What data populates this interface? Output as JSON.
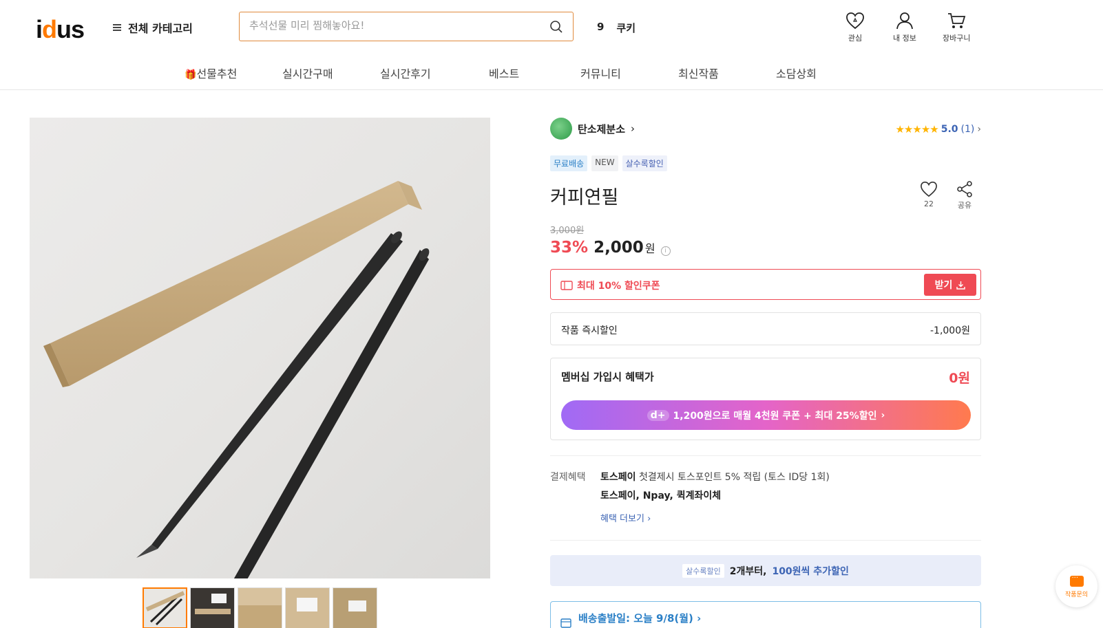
{
  "header": {
    "logo": {
      "left": "i",
      "o": "d",
      "right": "us"
    },
    "category_label": "전체 카테고리",
    "search_placeholder": "추석선물 미리 찜해놓아요!",
    "cookie_count": "9",
    "cookie_label": "쿠키",
    "icons": [
      {
        "name": "heart-icon",
        "label": "관심"
      },
      {
        "name": "user-icon",
        "label": "내 정보"
      },
      {
        "name": "cart-icon",
        "label": "장바구니"
      }
    ]
  },
  "nav": [
    {
      "label": "선물추천",
      "gift": true
    },
    {
      "label": "실시간구매"
    },
    {
      "label": "실시간후기"
    },
    {
      "label": "베스트"
    },
    {
      "label": "커뮤니티"
    },
    {
      "label": "최신작품"
    },
    {
      "label": "소담상회"
    }
  ],
  "product": {
    "shop_name": "탄소제분소",
    "rating_stars": "★★★★★",
    "rating_score": "5.0",
    "rating_count": "(1)",
    "badges": [
      "무료배송",
      "NEW",
      "살수록할인"
    ],
    "title": "커피연필",
    "like_count": "22",
    "share_label": "공유",
    "original_price": "3,000원",
    "discount_pct": "33%",
    "price": "2,000",
    "price_unit": "원",
    "coupon_text": "최대 10% 할인쿠폰",
    "coupon_button": "받기",
    "instant_label": "작품 즉시할인",
    "instant_value": "-1,000원",
    "member_label": "멤버십 가입시 혜택가",
    "member_value": "0원",
    "member_button": "1,200원으로 매월 4천원 쿠폰 + 최대 25%할인",
    "member_badge": "d+",
    "payment_label": "결제혜택",
    "payment_bold": "토스페이",
    "payment_line1": "첫결제시 토스포인트 5% 적립 (토스 ID당 1회)",
    "payment_line2": "토스페이, Npay, 퀵계좌이체",
    "payment_more": "혜택 더보기",
    "multi_tag": "살수록할인",
    "multi_text1": "2개부터,",
    "multi_text2": "100원씩 추가할인",
    "shipping_text": "배송출발일: 오늘 9/8(월)"
  },
  "inquiry_label": "작품문의"
}
